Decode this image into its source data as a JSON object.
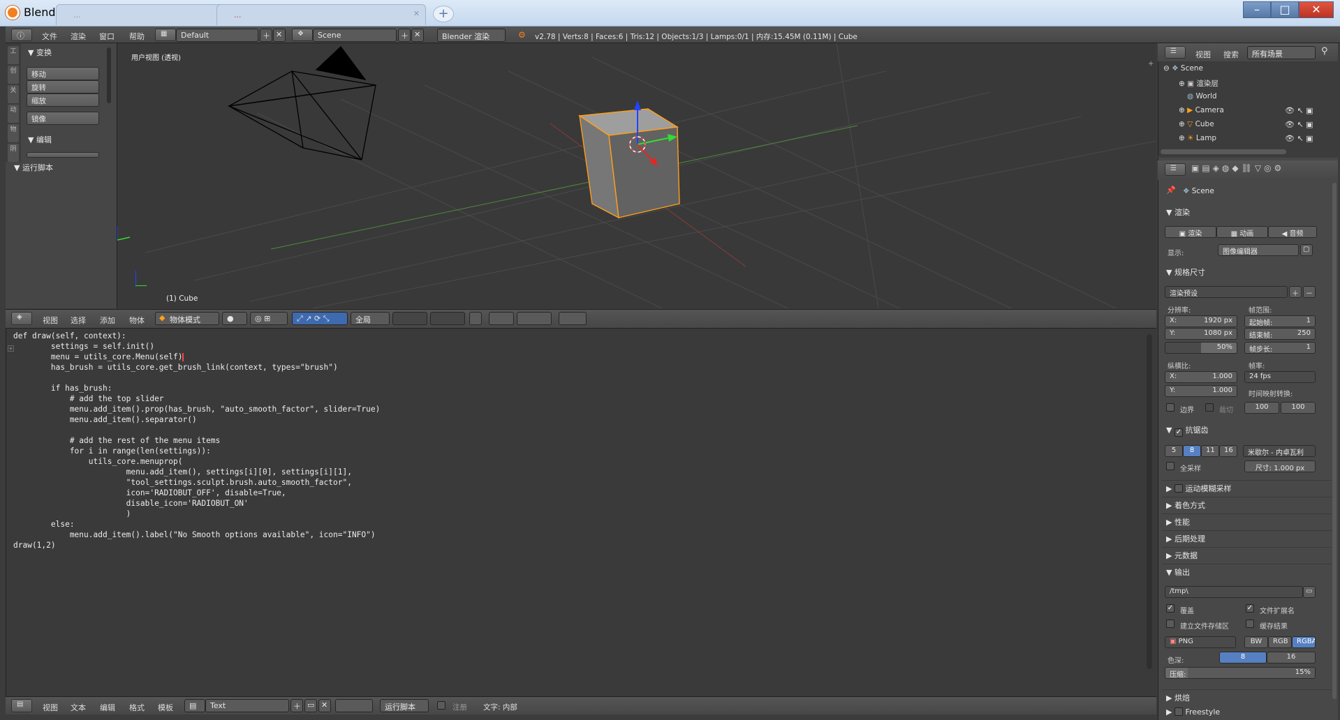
{
  "window": {
    "title": "Blender",
    "tab1": "...",
    "tab2": "..."
  },
  "menubar": {
    "menu": [
      "文件",
      "渲染",
      "窗口",
      "帮助"
    ],
    "layout": "Default",
    "scene": "Scene",
    "engine": "Blender 渲染",
    "stats": "v2.78 | Verts:8 | Faces:6 | Tris:12 | Objects:1/3 | Lamps:0/1 | 内存:15.45M (0.11M) | Cube"
  },
  "toolshelf": {
    "section_transform": "变换",
    "buttons": [
      "移动",
      "旋转",
      "缩放"
    ],
    "mirror": "镜像",
    "section_edit": "编辑",
    "run_script": "运行脚本",
    "tabs": [
      "工",
      "创",
      "关",
      "动",
      "物",
      "阴"
    ]
  },
  "viewport": {
    "view_label": "用户视图 (透视)",
    "object_label": "(1) Cube"
  },
  "viewport_header": {
    "menus": [
      "视图",
      "选择",
      "添加",
      "物体"
    ],
    "mode": "物体模式",
    "pivot": "全局"
  },
  "code": [
    "def draw(self, context):",
    "        settings = self.init()",
    "        menu = utils_core.Menu(self)",
    "        has_brush = utils_core.get_brush_link(context, types=\"brush\")",
    "",
    "        if has_brush:",
    "            # add the top slider",
    "            menu.add_item().prop(has_brush, \"auto_smooth_factor\", slider=True)",
    "            menu.add_item().separator()",
    "",
    "            # add the rest of the menu items",
    "            for i in range(len(settings)):",
    "                utils_core.menuprop(",
    "                        menu.add_item(), settings[i][0], settings[i][1],",
    "                        \"tool_settings.sculpt.brush.auto_smooth_factor\",",
    "                        icon='RADIOBUT_OFF', disable=True,",
    "                        disable_icon='RADIOBUT_ON'",
    "                        )",
    "        else:",
    "            menu.add_item().label(\"No Smooth options available\", icon=\"INFO\")",
    "draw(1,2)"
  ],
  "text_header": {
    "menus": [
      "视图",
      "文本",
      "编辑",
      "格式",
      "模板"
    ],
    "text_name": "Text",
    "run_script": "运行脚本",
    "register": "注册",
    "text_internal": "文字: 内部"
  },
  "outliner": {
    "menus": [
      "视图",
      "搜索"
    ],
    "scope": "所有场景",
    "items": [
      "Scene",
      "渲染层",
      "World",
      "Camera",
      "Cube",
      "Lamp"
    ]
  },
  "properties": {
    "context": "Scene",
    "render": {
      "title": "渲染",
      "buttons": [
        "渲染",
        "动画",
        "音频"
      ],
      "display_label": "显示:",
      "display_value": "图像编辑器"
    },
    "dimensions": {
      "title": "规格尺寸",
      "preset": "渲染预设",
      "resolution_label": "分辨率:",
      "res_x": "X:",
      "res_x_val": "1920 px",
      "res_y": "Y:",
      "res_y_val": "1080 px",
      "percent": "50%",
      "frame_range_label": "帧范围:",
      "start": "起始帧:",
      "start_val": "1",
      "end": "结束帧:",
      "end_val": "250",
      "step": "帧步长:",
      "step_val": "1",
      "aspect_label": "纵横比:",
      "asp_x": "X:",
      "asp_x_val": "1.000",
      "asp_y": "Y:",
      "asp_y_val": "1.000",
      "fps_label": "帧率:",
      "fps": "24 fps",
      "time_remap_label": "时间映射转换:",
      "remap_old": "100",
      "remap_new": "100",
      "border": "边界",
      "crop": "裁切"
    },
    "aa": {
      "title": "抗锯齿",
      "samples": [
        "5",
        "8",
        "11",
        "16"
      ],
      "filter": "米歇尔 - 内卓瓦利",
      "full_sample": "全采样",
      "size": "尺寸: 1.000 px"
    },
    "collapsed": [
      "运动模糊采样",
      "着色方式",
      "性能",
      "后期处理",
      "元数据"
    ],
    "output": {
      "title": "输出",
      "path": "/tmp\\",
      "overwrite": "覆盖",
      "file_ext": "文件扩展名",
      "placeholders": "建立文件存储区",
      "cache": "缓存结果",
      "format": "PNG",
      "color_modes": [
        "BW",
        "RGB",
        "RGBA"
      ],
      "depth_label": "色深:",
      "depths": [
        "8",
        "16"
      ],
      "compression_label": "压缩:",
      "compression": "15%"
    },
    "bake": "烘焙",
    "freestyle": "Freestyle"
  }
}
